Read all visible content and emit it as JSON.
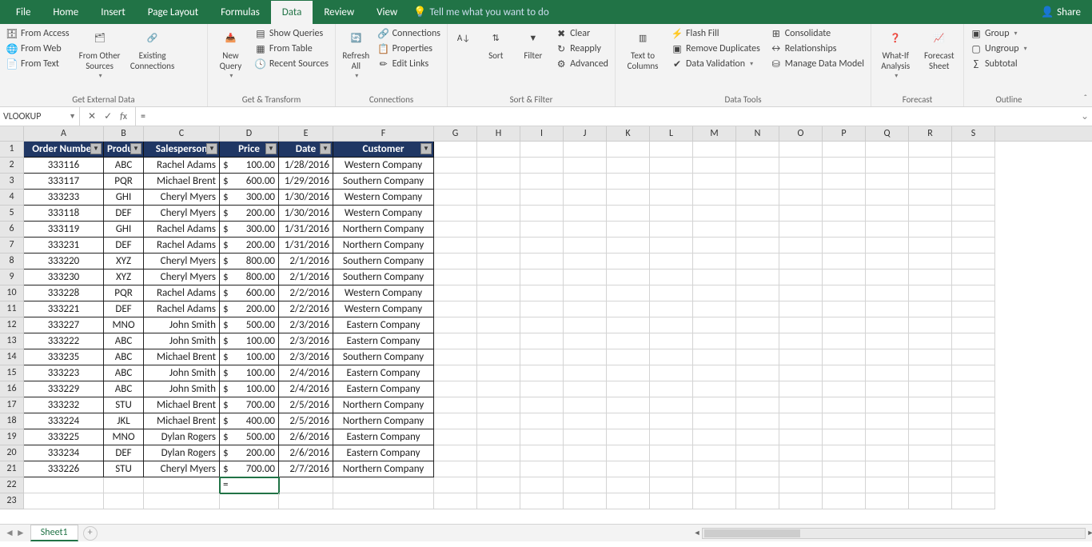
{
  "menu": {
    "tabs": [
      "File",
      "Home",
      "Insert",
      "Page Layout",
      "Formulas",
      "Data",
      "Review",
      "View"
    ],
    "active_index": 5,
    "tell_me": "Tell me what you want to do",
    "share": "Share"
  },
  "ribbon": {
    "groups": {
      "get_external": {
        "label": "Get External Data",
        "from_access": "From Access",
        "from_web": "From Web",
        "from_text": "From Text",
        "from_other": "From Other Sources",
        "existing": "Existing Connections"
      },
      "get_transform": {
        "label": "Get & Transform",
        "new_query": "New Query",
        "show_queries": "Show Queries",
        "from_table": "From Table",
        "recent_sources": "Recent Sources"
      },
      "connections": {
        "label": "Connections",
        "refresh_all": "Refresh All",
        "connections": "Connections",
        "properties": "Properties",
        "edit_links": "Edit Links"
      },
      "sort_filter": {
        "label": "Sort & Filter",
        "sort": "Sort",
        "filter": "Filter",
        "clear": "Clear",
        "reapply": "Reapply",
        "advanced": "Advanced"
      },
      "data_tools": {
        "label": "Data Tools",
        "text_to_columns": "Text to Columns",
        "flash_fill": "Flash Fill",
        "remove_dupes": "Remove Duplicates",
        "data_validation": "Data Validation",
        "consolidate": "Consolidate",
        "relationships": "Relationships",
        "manage_model": "Manage Data Model"
      },
      "forecast": {
        "label": "Forecast",
        "what_if": "What-If Analysis",
        "forecast_sheet": "Forecast Sheet"
      },
      "outline": {
        "label": "Outline",
        "group": "Group",
        "ungroup": "Ungroup",
        "subtotal": "Subtotal"
      }
    }
  },
  "formula_bar": {
    "name_box": "VLOOKUP",
    "formula": "="
  },
  "sheet": {
    "tab_name": "Sheet1",
    "active_cell": "D22",
    "editing_value": "=",
    "col_widths": {
      "A": 100,
      "B": 50,
      "C": 95,
      "D": 74,
      "E": 68,
      "F": 126,
      "rest": 54
    },
    "extra_cols": [
      "G",
      "H",
      "I",
      "J",
      "K",
      "L",
      "M",
      "N",
      "O",
      "P",
      "Q",
      "R",
      "S"
    ],
    "headers": [
      "Order Number",
      "Product",
      "Salesperson",
      "Price",
      "Date",
      "Customer"
    ],
    "rows": [
      {
        "n": "333116",
        "p": "ABC",
        "s": "Rachel Adams",
        "pr": "100.00",
        "d": "1/28/2016",
        "c": "Western Company"
      },
      {
        "n": "333117",
        "p": "PQR",
        "s": "Michael Brent",
        "pr": "600.00",
        "d": "1/29/2016",
        "c": "Southern Company"
      },
      {
        "n": "333233",
        "p": "GHI",
        "s": "Cheryl Myers",
        "pr": "300.00",
        "d": "1/30/2016",
        "c": "Western Company"
      },
      {
        "n": "333118",
        "p": "DEF",
        "s": "Cheryl Myers",
        "pr": "200.00",
        "d": "1/30/2016",
        "c": "Western Company"
      },
      {
        "n": "333119",
        "p": "GHI",
        "s": "Rachel Adams",
        "pr": "300.00",
        "d": "1/31/2016",
        "c": "Northern Company"
      },
      {
        "n": "333231",
        "p": "DEF",
        "s": "Rachel Adams",
        "pr": "200.00",
        "d": "1/31/2016",
        "c": "Northern Company"
      },
      {
        "n": "333220",
        "p": "XYZ",
        "s": "Cheryl Myers",
        "pr": "800.00",
        "d": "2/1/2016",
        "c": "Southern Company"
      },
      {
        "n": "333230",
        "p": "XYZ",
        "s": "Cheryl Myers",
        "pr": "800.00",
        "d": "2/1/2016",
        "c": "Southern Company"
      },
      {
        "n": "333228",
        "p": "PQR",
        "s": "Rachel Adams",
        "pr": "600.00",
        "d": "2/2/2016",
        "c": "Western Company"
      },
      {
        "n": "333221",
        "p": "DEF",
        "s": "Rachel Adams",
        "pr": "200.00",
        "d": "2/2/2016",
        "c": "Western Company"
      },
      {
        "n": "333227",
        "p": "MNO",
        "s": "John Smith",
        "pr": "500.00",
        "d": "2/3/2016",
        "c": "Eastern Company"
      },
      {
        "n": "333222",
        "p": "ABC",
        "s": "John Smith",
        "pr": "100.00",
        "d": "2/3/2016",
        "c": "Eastern Company"
      },
      {
        "n": "333235",
        "p": "ABC",
        "s": "Michael Brent",
        "pr": "100.00",
        "d": "2/3/2016",
        "c": "Southern Company"
      },
      {
        "n": "333223",
        "p": "ABC",
        "s": "John Smith",
        "pr": "100.00",
        "d": "2/4/2016",
        "c": "Eastern Company"
      },
      {
        "n": "333229",
        "p": "ABC",
        "s": "John Smith",
        "pr": "100.00",
        "d": "2/4/2016",
        "c": "Eastern Company"
      },
      {
        "n": "333232",
        "p": "STU",
        "s": "Michael Brent",
        "pr": "700.00",
        "d": "2/5/2016",
        "c": "Northern Company"
      },
      {
        "n": "333224",
        "p": "JKL",
        "s": "Michael Brent",
        "pr": "400.00",
        "d": "2/5/2016",
        "c": "Northern Company"
      },
      {
        "n": "333225",
        "p": "MNO",
        "s": "Dylan Rogers",
        "pr": "500.00",
        "d": "2/6/2016",
        "c": "Eastern Company"
      },
      {
        "n": "333234",
        "p": "DEF",
        "s": "Dylan Rogers",
        "pr": "200.00",
        "d": "2/6/2016",
        "c": "Eastern Company"
      },
      {
        "n": "333226",
        "p": "STU",
        "s": "Cheryl Myers",
        "pr": "700.00",
        "d": "2/7/2016",
        "c": "Northern Company"
      }
    ]
  }
}
